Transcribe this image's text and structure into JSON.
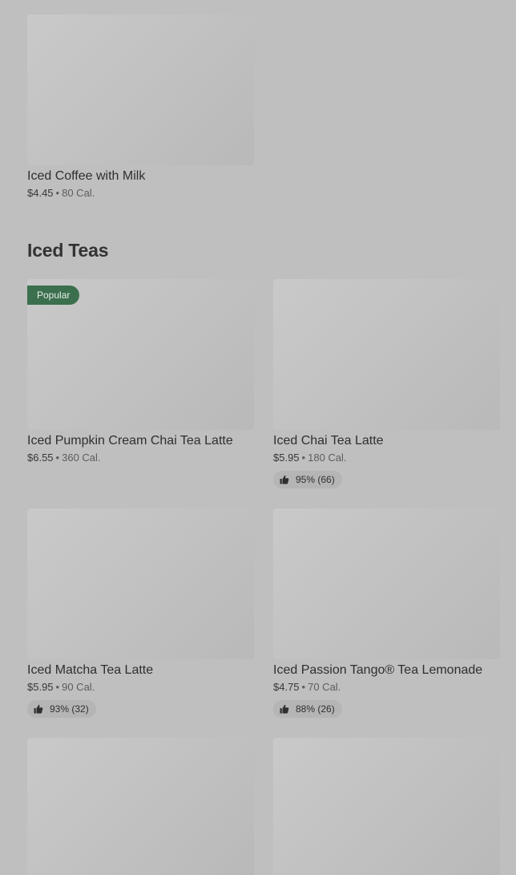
{
  "sections": {
    "iced_coffee_tail": {
      "items": [
        {
          "title": "Iced Coffee with Milk",
          "price": "$4.45",
          "separator": "•",
          "calories": "80 Cal."
        }
      ]
    },
    "iced_teas": {
      "title": "Iced Teas",
      "items": [
        {
          "title": "Iced Pumpkin Cream Chai Tea Latte",
          "price": "$6.55",
          "separator": "•",
          "calories": "360 Cal.",
          "badge": "Popular"
        },
        {
          "title": "Iced Chai Tea Latte",
          "price": "$5.95",
          "separator": "•",
          "calories": "180 Cal.",
          "rating": "95% (66)"
        },
        {
          "title": "Iced Matcha Tea Latte",
          "price": "$5.95",
          "separator": "•",
          "calories": "90 Cal.",
          "rating": "93% (32)"
        },
        {
          "title": "Iced Passion Tango® Tea Lemonade",
          "price": "$4.75",
          "separator": "•",
          "calories": "70 Cal.",
          "rating": "88% (26)"
        }
      ]
    }
  },
  "colors": {
    "overlay_background": "#bfbfbf",
    "badge_background": "#3b6f4d",
    "rating_pill_background": "#b5b5b5"
  },
  "icons": {
    "rating": "thumbs-up-icon"
  }
}
